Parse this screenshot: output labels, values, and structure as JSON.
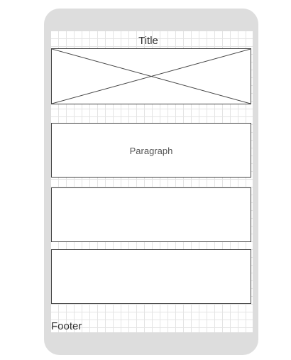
{
  "wireframe": {
    "title": "Title",
    "image_placeholder": "",
    "paragraph_label": "Paragraph",
    "footer": "Footer"
  },
  "colors": {
    "device_frame": "#dddddd",
    "screen": "#ffffff",
    "grid_lines": "#e4e4e4",
    "box_border": "#444444"
  }
}
